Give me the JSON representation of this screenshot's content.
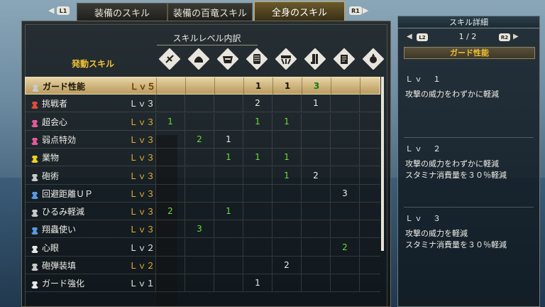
{
  "tabs": {
    "left_trigger": "L1",
    "right_trigger": "R1",
    "items": [
      {
        "label": "装備のスキル",
        "active": false
      },
      {
        "label": "装備の百竜スキル",
        "active": false
      },
      {
        "label": "全身のスキル",
        "active": true
      }
    ]
  },
  "main": {
    "title": "スキルレベル内訳",
    "activated_label": "発動スキル",
    "columns": [
      "weapon-icon",
      "helmet-icon",
      "chest-armor-icon",
      "arm-armor-icon",
      "waist-armor-icon",
      "leg-armor-icon",
      "charm-icon",
      "decoration-icon"
    ],
    "rows": [
      {
        "name": "ガード性能",
        "level": "Ｌｖ５",
        "icon_color": "#c9c9c9",
        "level_color": "orange",
        "selected": true,
        "cells": [
          "",
          "",
          "",
          "1",
          "1",
          "3",
          "",
          ""
        ],
        "green": [
          false,
          false,
          false,
          false,
          false,
          true,
          false,
          false
        ]
      },
      {
        "name": "挑戦者",
        "level": "Ｌｖ３",
        "icon_color": "#e24a3a",
        "level_color": "white",
        "selected": false,
        "cells": [
          "",
          "",
          "",
          "2",
          "",
          "1",
          "",
          ""
        ],
        "green": [
          false,
          false,
          false,
          false,
          false,
          false,
          false,
          false
        ]
      },
      {
        "name": "超会心",
        "level": "Ｌｖ３",
        "icon_color": "#e25a9a",
        "level_color": "orange",
        "selected": false,
        "cells": [
          "1",
          "",
          "",
          "1",
          "1",
          "",
          "",
          ""
        ],
        "green": [
          true,
          false,
          false,
          true,
          true,
          false,
          false,
          false
        ]
      },
      {
        "name": "弱点特効",
        "level": "Ｌｖ３",
        "icon_color": "#e25a9a",
        "level_color": "orange",
        "selected": false,
        "cells": [
          "",
          "2",
          "1",
          "",
          "",
          "",
          "",
          ""
        ],
        "green": [
          false,
          true,
          false,
          false,
          false,
          false,
          false,
          false
        ]
      },
      {
        "name": "業物",
        "level": "Ｌｖ３",
        "icon_color": "#f0d020",
        "level_color": "orange",
        "selected": false,
        "cells": [
          "",
          "",
          "1",
          "1",
          "1",
          "",
          "",
          ""
        ],
        "green": [
          false,
          false,
          true,
          true,
          true,
          false,
          false,
          false
        ]
      },
      {
        "name": "砲術",
        "level": "Ｌｖ３",
        "icon_color": "#c9c9c9",
        "level_color": "orange",
        "selected": false,
        "cells": [
          "",
          "",
          "",
          "",
          "1",
          "2",
          "",
          ""
        ],
        "green": [
          false,
          false,
          false,
          false,
          true,
          false,
          false,
          false
        ]
      },
      {
        "name": "回避距離ＵＰ",
        "level": "Ｌｖ３",
        "icon_color": "#5a9ae2",
        "level_color": "orange",
        "selected": false,
        "cells": [
          "",
          "",
          "",
          "",
          "",
          "",
          "3",
          ""
        ],
        "green": [
          false,
          false,
          false,
          false,
          false,
          false,
          false,
          false
        ]
      },
      {
        "name": "ひるみ軽減",
        "level": "Ｌｖ３",
        "icon_color": "#c9c9c9",
        "level_color": "orange",
        "selected": false,
        "cells": [
          "2",
          "",
          "1",
          "",
          "",
          "",
          "",
          ""
        ],
        "green": [
          true,
          false,
          true,
          false,
          false,
          false,
          false,
          false
        ]
      },
      {
        "name": "翔蟲使い",
        "level": "Ｌｖ３",
        "icon_color": "#5a9ae2",
        "level_color": "orange",
        "selected": false,
        "cells": [
          "",
          "3",
          "",
          "",
          "",
          "",
          "",
          ""
        ],
        "green": [
          false,
          true,
          false,
          false,
          false,
          false,
          false,
          false
        ]
      },
      {
        "name": "心眼",
        "level": "Ｌｖ２",
        "icon_color": "#e6e6e6",
        "level_color": "white",
        "selected": false,
        "cells": [
          "",
          "",
          "",
          "",
          "",
          "",
          "2",
          ""
        ],
        "green": [
          false,
          false,
          false,
          false,
          false,
          false,
          true,
          false
        ]
      },
      {
        "name": "砲弾装填",
        "level": "Ｌｖ２",
        "icon_color": "#c9c9c9",
        "level_color": "orange",
        "selected": false,
        "cells": [
          "",
          "",
          "",
          "",
          "2",
          "",
          "",
          ""
        ],
        "green": [
          false,
          false,
          false,
          false,
          false,
          false,
          false,
          false
        ]
      },
      {
        "name": "ガード強化",
        "level": "Ｌｖ１",
        "icon_color": "#e6e6e6",
        "level_color": "white",
        "selected": false,
        "cells": [
          "",
          "",
          "",
          "1",
          "",
          "",
          "",
          ""
        ],
        "green": [
          false,
          false,
          false,
          false,
          false,
          false,
          false,
          false
        ]
      }
    ]
  },
  "detail": {
    "header": "スキル詳細",
    "left_button": "L2",
    "right_button": "R2",
    "page": "1 / 2",
    "skill_title": "ガード性能",
    "levels": [
      {
        "level": "Ｌｖ　１",
        "lines": [
          "攻撃の威力をわずかに軽減"
        ]
      },
      {
        "level": "Ｌｖ　２",
        "lines": [
          "攻撃の威力をわずかに軽減",
          "スタミナ消費量を３０％軽減"
        ]
      },
      {
        "level": "Ｌｖ　３",
        "lines": [
          "攻撃の威力を軽減",
          "スタミナ消費量を３０％軽減"
        ]
      }
    ]
  },
  "colors": {
    "accent_gold": "#f1c232",
    "green_value": "#6ddc3a"
  }
}
